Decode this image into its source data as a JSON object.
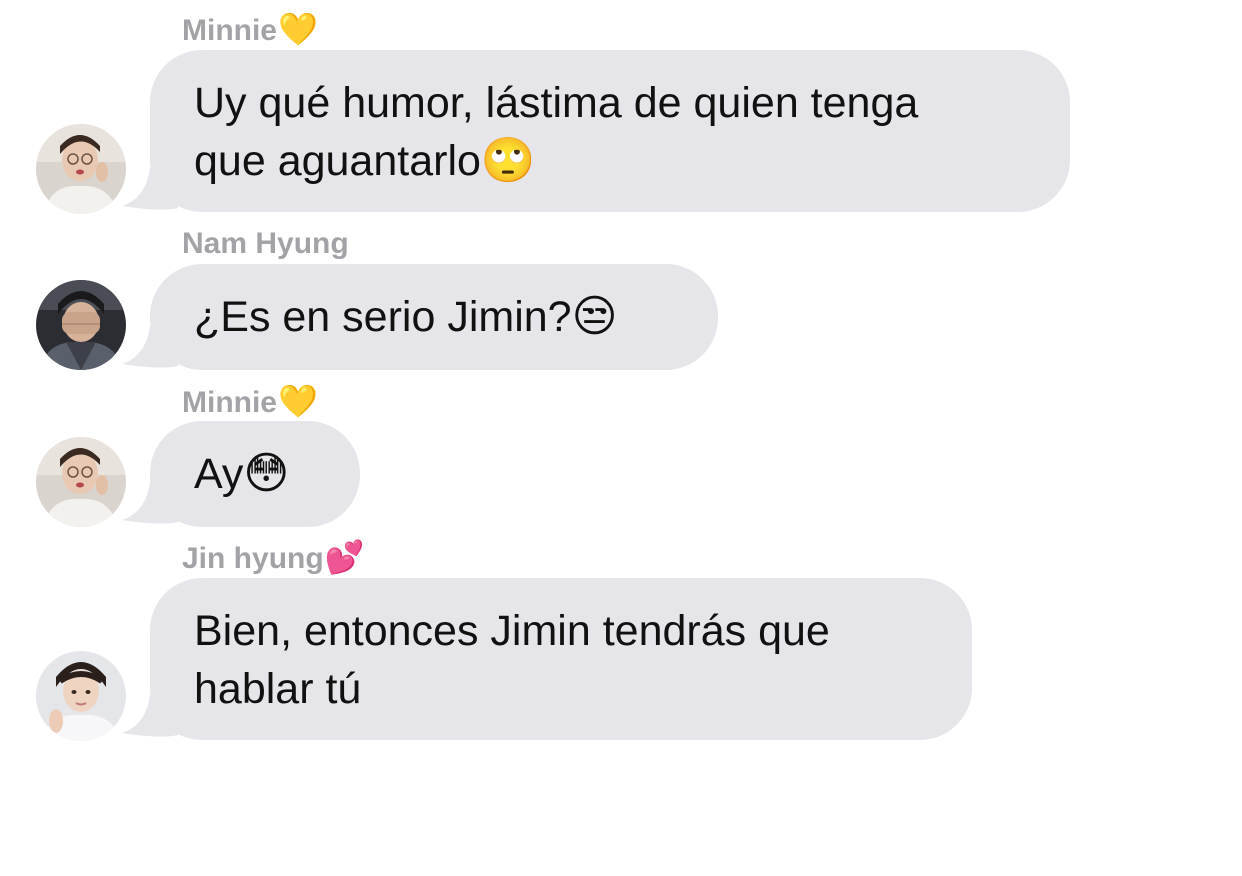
{
  "messages": [
    {
      "sender": "Minnie",
      "sender_emoji": "💛",
      "avatar": "jimin-avatar",
      "lines": [
        "Uy qué humor, lástima de quien tenga",
        "que aguantarlo"
      ],
      "trailing_emoji": "🙄"
    },
    {
      "sender": "Nam Hyung",
      "sender_emoji": "",
      "avatar": "namjoon-avatar",
      "lines": [
        "¿Es en serio Jimin?"
      ],
      "trailing_emoji": "😒"
    },
    {
      "sender": "Minnie",
      "sender_emoji": "💛",
      "avatar": "jimin-avatar",
      "lines": [
        "Ay"
      ],
      "trailing_emoji": "😳"
    },
    {
      "sender": "Jin hyung",
      "sender_emoji": "💕",
      "avatar": "jin-avatar",
      "lines": [
        "Bien, entonces Jimin tendrás que",
        "hablar tú"
      ],
      "trailing_emoji": ""
    }
  ],
  "colors": {
    "bubble": "#e6e5ea",
    "sender_text": "#a2a2a7",
    "message_text": "#111111",
    "background": "#ffffff"
  }
}
